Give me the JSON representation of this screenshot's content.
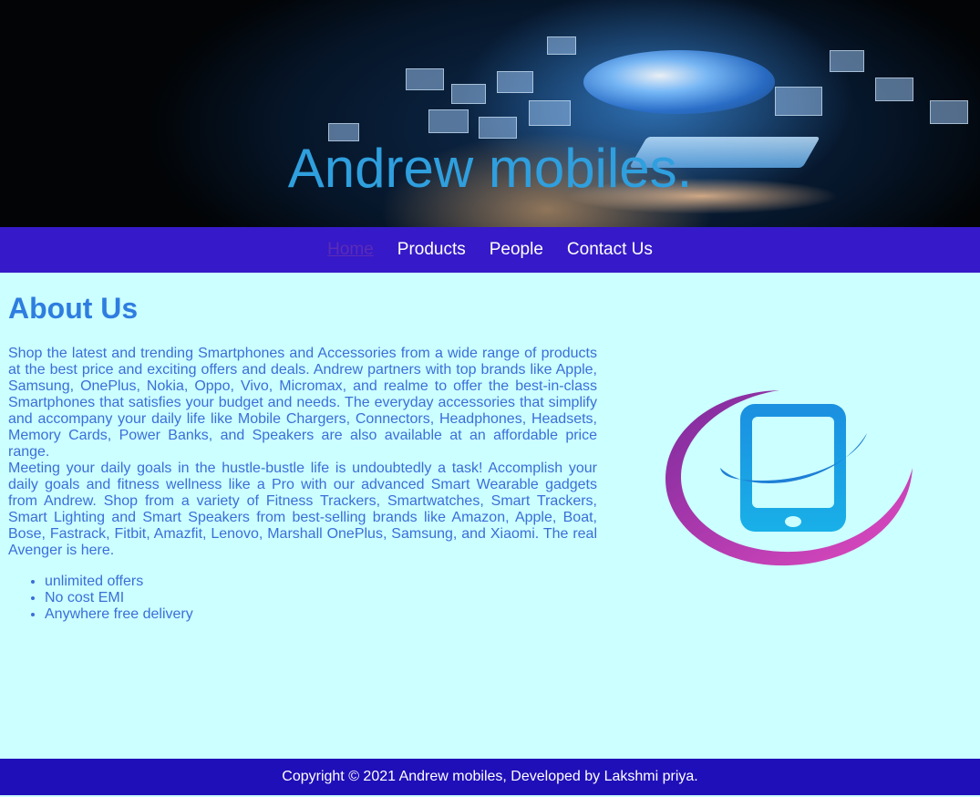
{
  "header": {
    "title": "Andrew mobiles."
  },
  "nav": {
    "items": [
      {
        "label": "Home",
        "active": true
      },
      {
        "label": "Products",
        "active": false
      },
      {
        "label": "People",
        "active": false
      },
      {
        "label": "Contact Us",
        "active": false
      }
    ]
  },
  "about": {
    "heading": "About Us",
    "paragraphs": [
      "Shop the latest and trending Smartphones and Accessories from a wide range of products at the best price and exciting offers and deals. Andrew partners with top brands like Apple, Samsung, OnePlus, Nokia, Oppo, Vivo, Micromax, and realme to offer the best-in-class Smartphones that satisfies your budget and needs. The everyday accessories that simplify and accompany your daily life like Mobile Chargers, Connectors, Headphones, Headsets, Memory Cards, Power Banks, and Speakers are also available at an affordable price range.",
      "Meeting your daily goals in the hustle-bustle life is undoubtedly a task! Accomplish your daily goals and fitness wellness like a Pro with our advanced Smart Wearable gadgets from Andrew. Shop from a variety of Fitness Trackers, Smartwatches, Smart Trackers, Smart Lighting and Smart Speakers from best-selling brands like Amazon, Apple, Boat, Bose, Fastrack, Fitbit, Amazfit, Lenovo, Marshall OnePlus, Samsung, and Xiaomi. The real Avenger is here."
    ],
    "features": [
      "unlimited offers",
      "No cost EMI",
      "Anywhere free delivery"
    ]
  },
  "logo": {
    "icon": "mobile-phone-logo-icon"
  },
  "footer": {
    "text": "Copyright © 2021 Andrew mobiles, Developed by Lakshmi priya."
  },
  "colors": {
    "page_bg": "#ccffff",
    "nav_bg": "#3619c8",
    "footer_bg": "#1f0fb8",
    "title": "#2f9fde",
    "text": "#3a6fd8",
    "active_link": "#5b2cb8"
  }
}
